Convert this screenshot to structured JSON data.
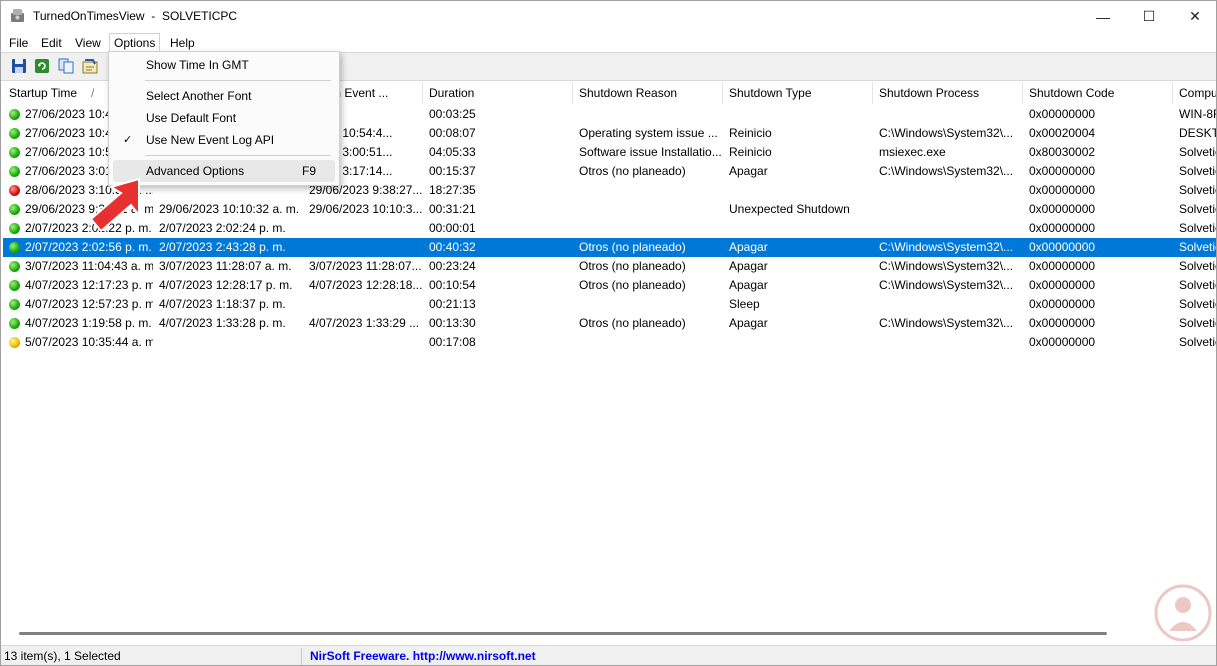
{
  "window": {
    "app_name": "TurnedOnTimesView",
    "computer": "SOLVETICPC",
    "controls": {
      "minimize": "—",
      "maximize": "☐",
      "close": "✕"
    }
  },
  "menu": [
    "File",
    "Edit",
    "View",
    "Options",
    "Help"
  ],
  "options_menu": {
    "items": [
      {
        "label": "Show Time In GMT",
        "checked": false,
        "shortcut": ""
      },
      {
        "label": "Select Another Font",
        "checked": false,
        "shortcut": ""
      },
      {
        "label": "Use Default Font",
        "checked": false,
        "shortcut": ""
      },
      {
        "label": "Use New Event Log API",
        "checked": true,
        "shortcut": ""
      },
      {
        "label": "Advanced Options",
        "checked": false,
        "shortcut": "F9",
        "hover": true
      }
    ],
    "check_glyph": "✓"
  },
  "columns": [
    "Startup Time",
    "",
    "ystem Event ...",
    "Duration",
    "Shutdown Reason",
    "Shutdown Type",
    "Shutdown Process",
    "Shutdown Code",
    "Compu"
  ],
  "sort_indicator": "/",
  "rows": [
    {
      "status": "green",
      "selected": false,
      "cells": [
        "27/06/2023 10:4",
        "",
        "",
        "00:03:25",
        "",
        "",
        "",
        "0x00000000",
        "WIN-8R"
      ]
    },
    {
      "status": "green",
      "selected": false,
      "cells": [
        "27/06/2023 10:4",
        "",
        "/2023 10:54:4...",
        "00:08:07",
        "Operating system issue ...",
        "Reinicio",
        "C:\\Windows\\System32\\...",
        "0x00020004",
        "DESKTO"
      ]
    },
    {
      "status": "green",
      "selected": false,
      "cells": [
        "27/06/2023 10:5",
        "",
        "/2023 3:00:51...",
        "04:05:33",
        "Software issue Installatio...",
        "Reinicio",
        "msiexec.exe",
        "0x80030002",
        "Solvetic"
      ]
    },
    {
      "status": "green",
      "selected": false,
      "cells": [
        "27/06/2023 3:01",
        "",
        "/2023 3:17:14...",
        "00:15:37",
        "Otros (no planeado)",
        "Apagar",
        "C:\\Windows\\System32\\...",
        "0x00000000",
        "Solvetic"
      ]
    },
    {
      "status": "red",
      "selected": false,
      "cells": [
        "28/06/2023 3:10:52 p. ...",
        "",
        "29/06/2023 9:38:27...",
        "18:27:35",
        "",
        "",
        "",
        "0x00000000",
        "Solvetic"
      ]
    },
    {
      "status": "green",
      "selected": false,
      "cells": [
        "29/06/2023 9:39:11 a. m.",
        "29/06/2023 10:10:32 a. m.",
        "29/06/2023 10:10:3...",
        "00:31:21",
        "",
        "Unexpected Shutdown",
        "",
        "0x00000000",
        "Solvetic"
      ]
    },
    {
      "status": "green",
      "selected": false,
      "cells": [
        "2/07/2023 2:02:22 p. m.",
        "2/07/2023 2:02:24 p. m.",
        "",
        "00:00:01",
        "",
        "",
        "",
        "0x00000000",
        "Solvetic"
      ]
    },
    {
      "status": "green",
      "selected": true,
      "cells": [
        "2/07/2023 2:02:56 p. m.",
        "2/07/2023 2:43:28 p. m.",
        "",
        "00:40:32",
        "Otros (no planeado)",
        "Apagar",
        "C:\\Windows\\System32\\...",
        "0x00000000",
        "Solvetic"
      ]
    },
    {
      "status": "green",
      "selected": false,
      "cells": [
        "3/07/2023 11:04:43 a. m.",
        "3/07/2023 11:28:07 a. m.",
        "3/07/2023 11:28:07...",
        "00:23:24",
        "Otros (no planeado)",
        "Apagar",
        "C:\\Windows\\System32\\...",
        "0x00000000",
        "Solvetic"
      ]
    },
    {
      "status": "green",
      "selected": false,
      "cells": [
        "4/07/2023 12:17:23 p. m.",
        "4/07/2023 12:28:17 p. m.",
        "4/07/2023 12:28:18...",
        "00:10:54",
        "Otros (no planeado)",
        "Apagar",
        "C:\\Windows\\System32\\...",
        "0x00000000",
        "Solvetic"
      ]
    },
    {
      "status": "green",
      "selected": false,
      "cells": [
        "4/07/2023 12:57:23 p. m.",
        "4/07/2023 1:18:37 p. m.",
        "",
        "00:21:13",
        "",
        "Sleep",
        "",
        "0x00000000",
        "Solvetic"
      ]
    },
    {
      "status": "green",
      "selected": false,
      "cells": [
        "4/07/2023 1:19:58 p. m.",
        "4/07/2023 1:33:28 p. m.",
        "4/07/2023 1:33:29 ...",
        "00:13:30",
        "Otros (no planeado)",
        "Apagar",
        "C:\\Windows\\System32\\...",
        "0x00000000",
        "Solvetic"
      ]
    },
    {
      "status": "yellow",
      "selected": false,
      "cells": [
        "5/07/2023 10:35:44 a. m.",
        "",
        "",
        "00:17:08",
        "",
        "",
        "",
        "0x00000000",
        "Solvetic"
      ]
    }
  ],
  "status": {
    "items": "13 item(s), 1 Selected",
    "freeware": "NirSoft Freeware.  http://www.nirsoft.net"
  }
}
